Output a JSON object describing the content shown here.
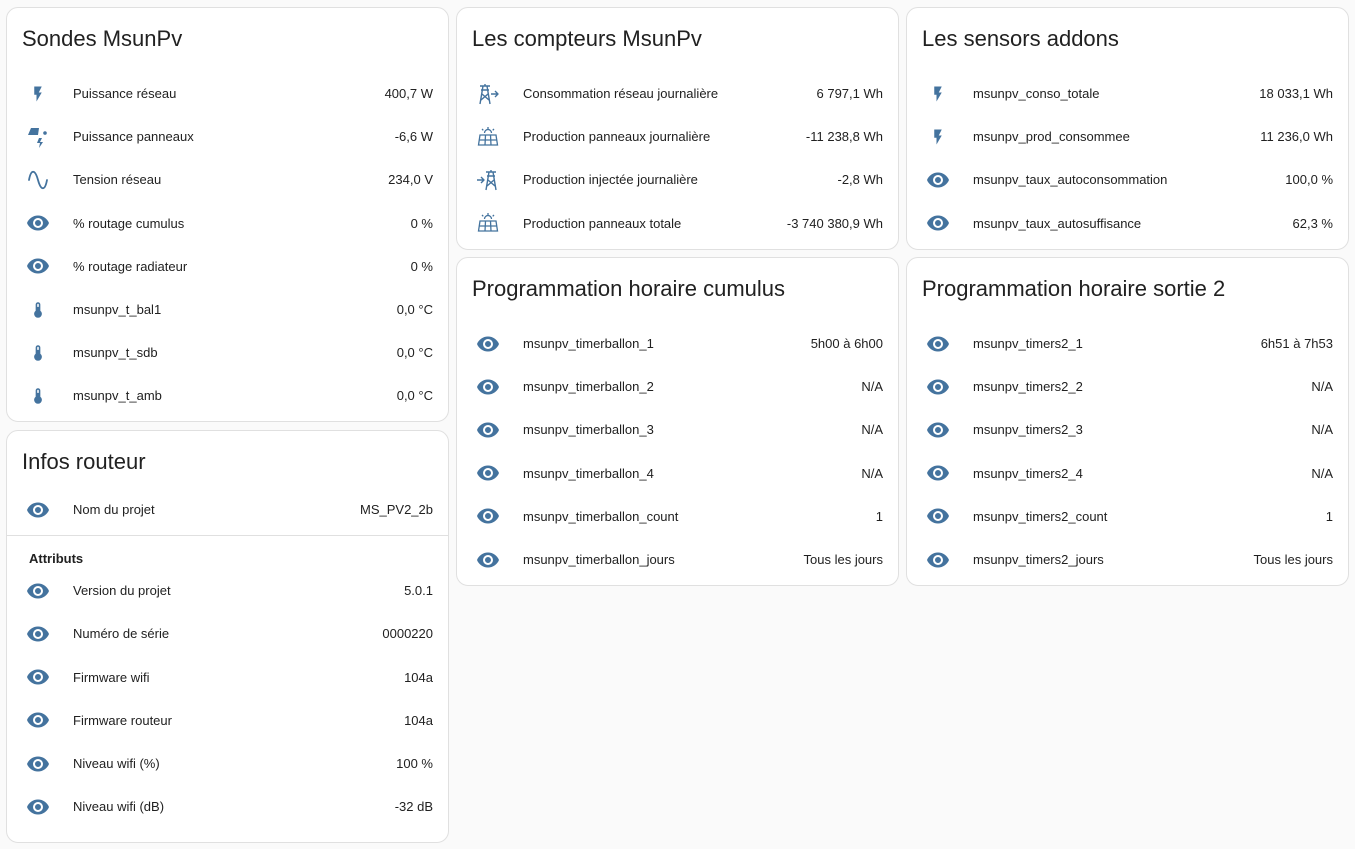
{
  "colors": {
    "icon": "#44739e",
    "card_bg": "#ffffff",
    "page_bg": "#fafafa",
    "border": "#e0e0e0"
  },
  "cards": {
    "sondes": {
      "title": "Sondes MsunPv",
      "rows": [
        {
          "icon": "flash-icon",
          "label": "Puissance réseau",
          "value": "400,7 W"
        },
        {
          "icon": "solar-power-icon",
          "label": "Puissance panneaux",
          "value": "-6,6 W"
        },
        {
          "icon": "sine-wave-icon",
          "label": "Tension réseau",
          "value": "234,0 V"
        },
        {
          "icon": "eye-icon",
          "label": "% routage cumulus",
          "value": "0 %"
        },
        {
          "icon": "eye-icon",
          "label": "% routage radiateur",
          "value": "0 %"
        },
        {
          "icon": "thermometer-icon",
          "label": "msunpv_t_bal1",
          "value": "0,0 °C"
        },
        {
          "icon": "thermometer-icon",
          "label": "msunpv_t_sdb",
          "value": "0,0 °C"
        },
        {
          "icon": "thermometer-icon",
          "label": "msunpv_t_amb",
          "value": "0,0 °C"
        }
      ]
    },
    "infos": {
      "title": "Infos routeur",
      "main_row": {
        "icon": "eye-icon",
        "label": "Nom du projet",
        "value": "MS_PV2_2b"
      },
      "attributes_label": "Attributs",
      "rows": [
        {
          "icon": "eye-icon",
          "label": "Version du projet",
          "value": "5.0.1"
        },
        {
          "icon": "eye-icon",
          "label": "Numéro de série",
          "value": "0000220"
        },
        {
          "icon": "eye-icon",
          "label": "Firmware wifi",
          "value": "104a"
        },
        {
          "icon": "eye-icon",
          "label": "Firmware routeur",
          "value": "104a"
        },
        {
          "icon": "eye-icon",
          "label": "Niveau wifi (%)",
          "value": "100 %"
        },
        {
          "icon": "eye-icon",
          "label": "Niveau wifi (dB)",
          "value": "-32 dB"
        }
      ]
    },
    "compteurs": {
      "title": "Les compteurs MsunPv",
      "rows": [
        {
          "icon": "transmission-tower-import-icon",
          "label": "Consommation réseau journalière",
          "value": "6 797,1 Wh"
        },
        {
          "icon": "solar-panel-icon",
          "label": "Production panneaux journalière",
          "value": "-11 238,8 Wh"
        },
        {
          "icon": "transmission-tower-export-icon",
          "label": "Production injectée journalière",
          "value": "-2,8 Wh"
        },
        {
          "icon": "solar-panel-icon",
          "label": "Production panneaux totale",
          "value": "-3 740 380,9 Wh"
        }
      ]
    },
    "sensors": {
      "title": "Les sensors addons",
      "rows": [
        {
          "icon": "flash-icon",
          "label": "msunpv_conso_totale",
          "value": "18 033,1 Wh"
        },
        {
          "icon": "flash-icon",
          "label": "msunpv_prod_consommee",
          "value": "11 236,0 Wh"
        },
        {
          "icon": "eye-icon",
          "label": "msunpv_taux_autoconsommation",
          "value": "100,0 %"
        },
        {
          "icon": "eye-icon",
          "label": "msunpv_taux_autosuffisance",
          "value": "62,3 %"
        }
      ]
    },
    "cumulus": {
      "title": "Programmation horaire cumulus",
      "rows": [
        {
          "icon": "eye-icon",
          "label": "msunpv_timerballon_1",
          "value": "5h00 à 6h00"
        },
        {
          "icon": "eye-icon",
          "label": "msunpv_timerballon_2",
          "value": "N/A"
        },
        {
          "icon": "eye-icon",
          "label": "msunpv_timerballon_3",
          "value": "N/A"
        },
        {
          "icon": "eye-icon",
          "label": "msunpv_timerballon_4",
          "value": "N/A"
        },
        {
          "icon": "eye-icon",
          "label": "msunpv_timerballon_count",
          "value": "1"
        },
        {
          "icon": "eye-icon",
          "label": "msunpv_timerballon_jours",
          "value": "Tous les jours"
        }
      ]
    },
    "sortie2": {
      "title": "Programmation horaire sortie 2",
      "rows": [
        {
          "icon": "eye-icon",
          "label": "msunpv_timers2_1",
          "value": "6h51 à 7h53"
        },
        {
          "icon": "eye-icon",
          "label": "msunpv_timers2_2",
          "value": "N/A"
        },
        {
          "icon": "eye-icon",
          "label": "msunpv_timers2_3",
          "value": "N/A"
        },
        {
          "icon": "eye-icon",
          "label": "msunpv_timers2_4",
          "value": "N/A"
        },
        {
          "icon": "eye-icon",
          "label": "msunpv_timers2_count",
          "value": "1"
        },
        {
          "icon": "eye-icon",
          "label": "msunpv_timers2_jours",
          "value": "Tous les jours"
        }
      ]
    }
  }
}
